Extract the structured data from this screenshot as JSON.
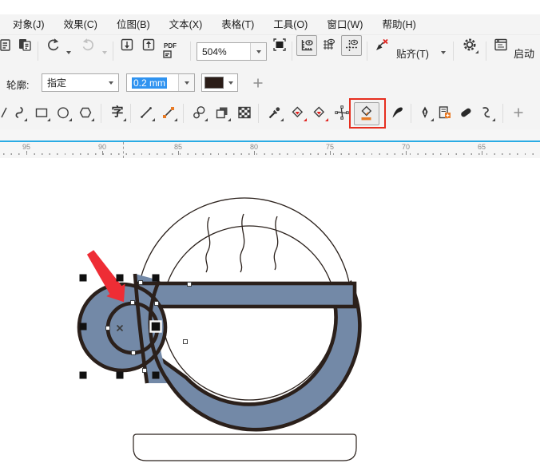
{
  "menu_bar": {
    "items": [
      {
        "label": "对象(J)"
      },
      {
        "label": "效果(C)"
      },
      {
        "label": "位图(B)"
      },
      {
        "label": "文本(X)"
      },
      {
        "label": "表格(T)"
      },
      {
        "label": "工具(O)"
      },
      {
        "label": "窗口(W)"
      },
      {
        "label": "帮助(H)"
      }
    ]
  },
  "standard_toolbar": {
    "zoom_level": "504%",
    "pdf_label": "PDF",
    "snap_to_label": "贴齐(T)",
    "launch_label": "启动"
  },
  "property_bar": {
    "outline_label": "轮廓:",
    "outline_style": "指定",
    "outline_width": "0.2 mm"
  },
  "toolbox": {
    "text_tool_glyph": "字"
  },
  "ruler": {
    "ticks": [
      "95",
      "90",
      "85",
      "80",
      "75",
      "70",
      "65"
    ]
  },
  "colors": {
    "cup_fill": "#7389a7",
    "cup_outline": "#2b201b",
    "thin_outline": "#2b211c",
    "arrow_red": "#ee2d35",
    "highlight_red": "#e62e1f",
    "selection_bg": "#2f93f0",
    "ruler_blue": "#2aabe4",
    "icon_orange": "#e87a25"
  }
}
